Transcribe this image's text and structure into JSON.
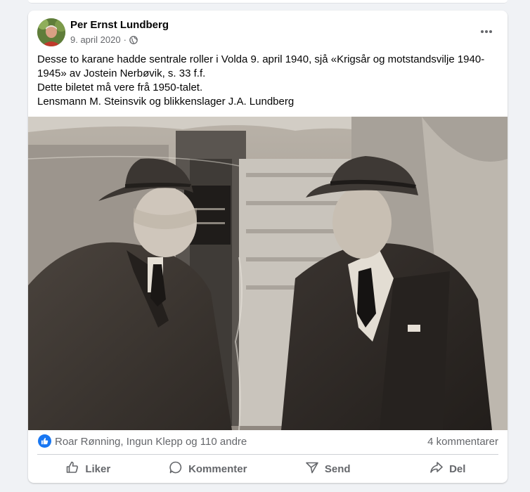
{
  "post": {
    "author": "Per Ernst Lundberg",
    "date": "9. april 2020",
    "separator": "·",
    "text_lines": [
      "Desse to karane hadde sentrale roller i Volda 9. april 1940, sjå «Krigsår og motstandsvilje 1940-",
      "1945» av Jostein Nerbøvik, s. 33 f.f.",
      "Dette biletet må vere frå 1950-talet.",
      "Lensmann M. Steinsvik og blikkenslager J.A. Lundberg"
    ],
    "reactions_text": "Roar Rønning, Ingun Klepp og 110 andre",
    "comments_text": "4 kommentarer"
  },
  "actions": {
    "like": "Liker",
    "comment": "Kommenter",
    "send": "Send",
    "share": "Del"
  },
  "colors": {
    "accent": "#1877f2",
    "secondary_text": "#65676b",
    "page_bg": "#f0f2f5"
  },
  "icons": [
    "globe-icon",
    "more-icon",
    "like-reaction-icon",
    "thumbs-up-icon",
    "comment-icon",
    "send-icon",
    "share-icon"
  ]
}
